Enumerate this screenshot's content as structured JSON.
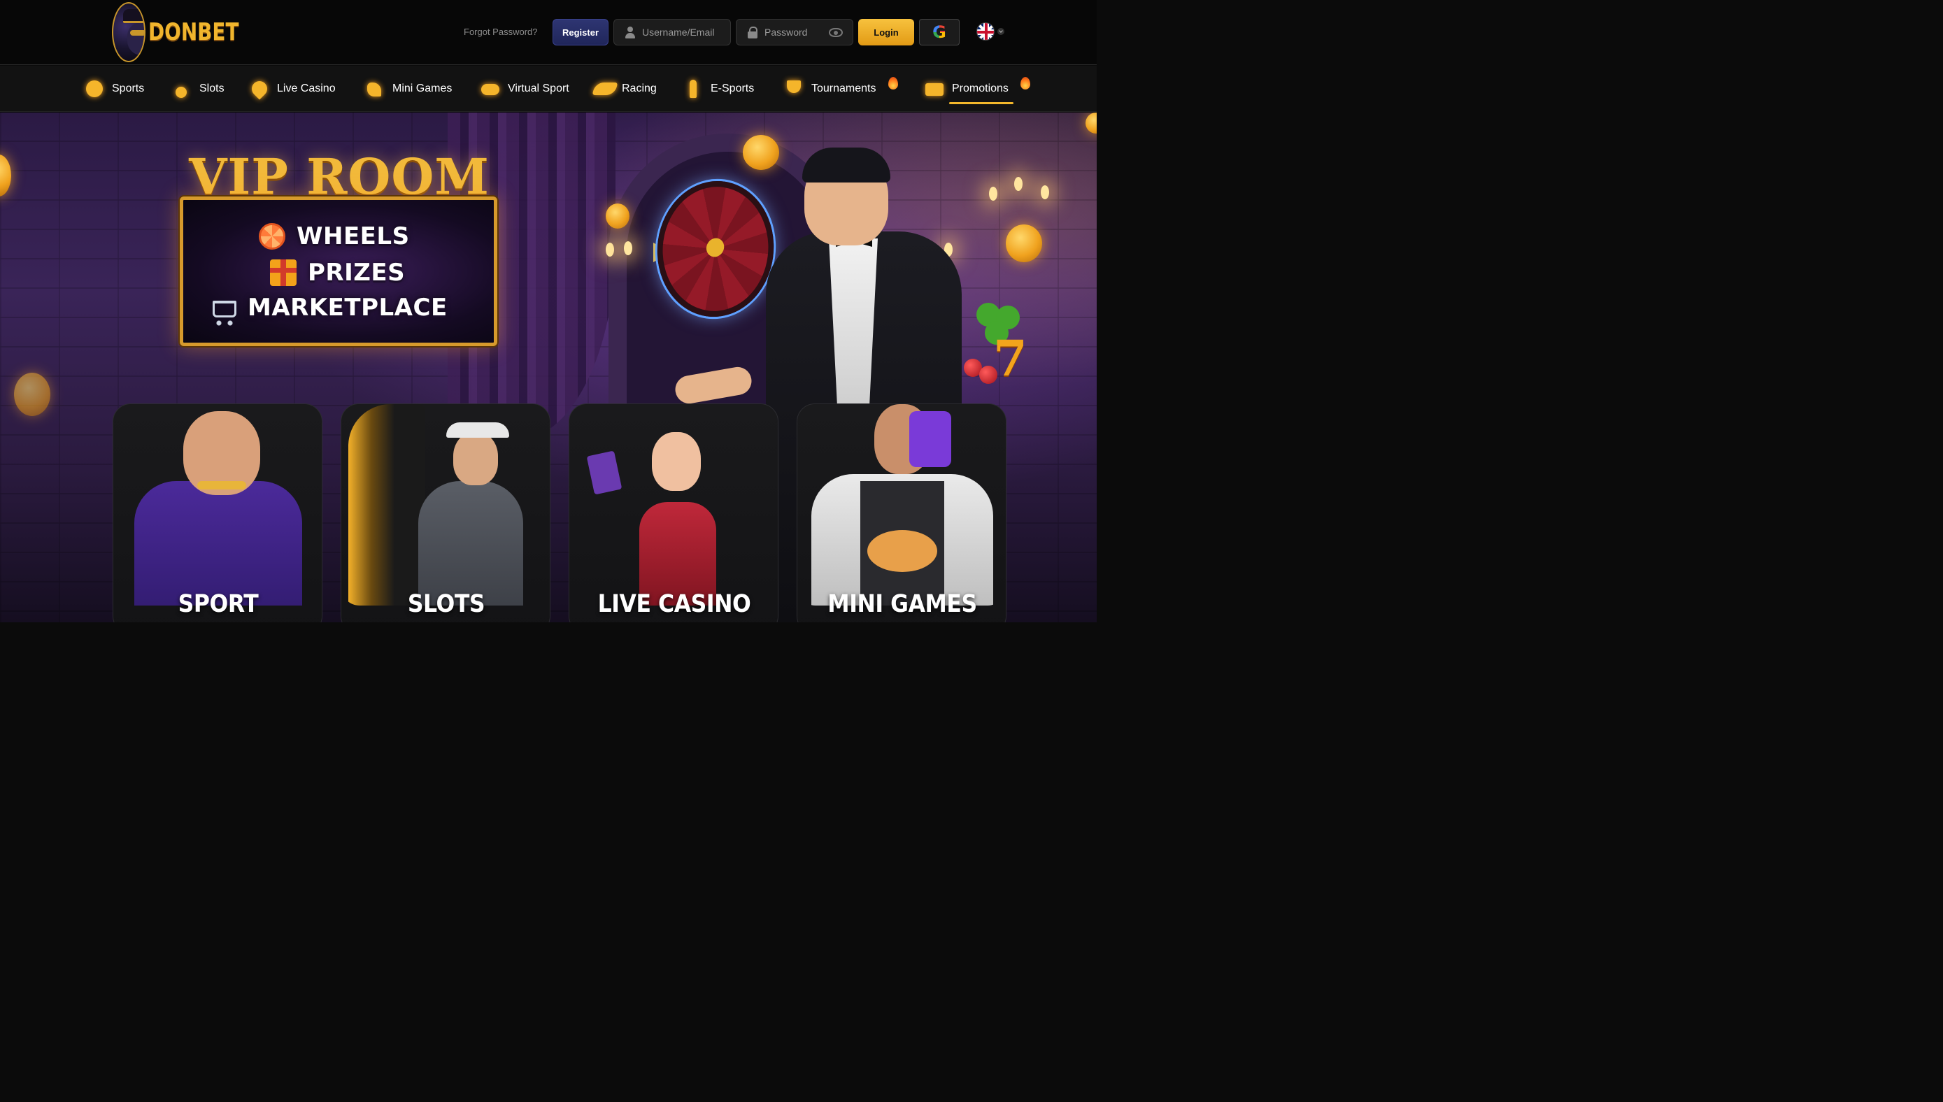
{
  "brand": {
    "name": "DONBET"
  },
  "header": {
    "forgot_password": "Forgot Password?",
    "register_label": "Register",
    "username_placeholder": "Username/Email",
    "password_placeholder": "Password",
    "login_label": "Login",
    "google_letter": "G",
    "language_icon": "uk-flag-icon"
  },
  "nav": {
    "items": [
      {
        "label": "Sports",
        "icon": "basketball-icon"
      },
      {
        "label": "Slots",
        "icon": "cherry-icon"
      },
      {
        "label": "Live Casino",
        "icon": "spade-icon"
      },
      {
        "label": "Mini Games",
        "icon": "dino-icon"
      },
      {
        "label": "Virtual Sport",
        "icon": "gamepad-icon"
      },
      {
        "label": "Racing",
        "icon": "horse-icon"
      },
      {
        "label": "E-Sports",
        "icon": "soldier-icon"
      },
      {
        "label": "Tournaments",
        "icon": "trophy-icon",
        "badge": "fire-icon"
      },
      {
        "label": "Promotions",
        "icon": "ticket-icon",
        "badge": "fire-icon",
        "active": true
      }
    ]
  },
  "banner": {
    "title": "VIP ROOM",
    "features": [
      {
        "label": "WHEELS",
        "icon": "wheel-icon"
      },
      {
        "label": "PRIZES",
        "icon": "gift-icon"
      },
      {
        "label": "MARKETPLACE",
        "icon": "cart-icon"
      }
    ]
  },
  "categories": [
    {
      "label": "SPORT"
    },
    {
      "label": "SLOTS"
    },
    {
      "label": "LIVE CASINO"
    },
    {
      "label": "MINI GAMES"
    }
  ],
  "colors": {
    "accent_gold": "#f4b82c",
    "register_bg": "#2e3572",
    "background": "#0b0b0b"
  }
}
